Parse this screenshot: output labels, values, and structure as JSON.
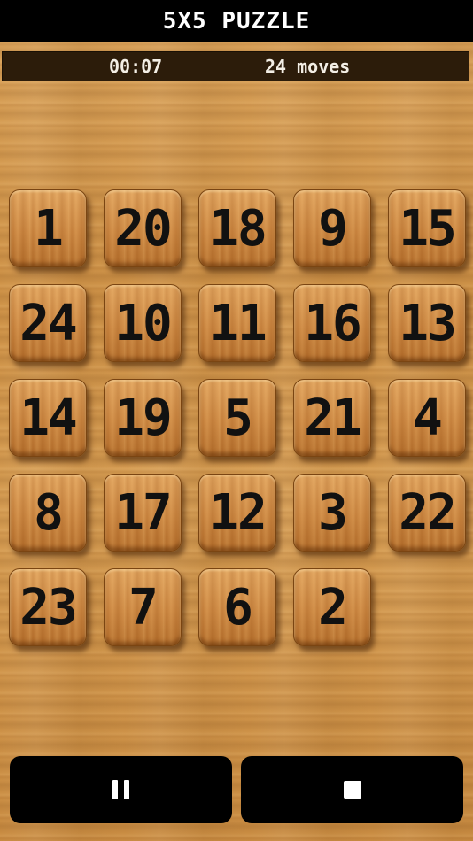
{
  "header": {
    "title": "5X5 PUZZLE"
  },
  "status": {
    "time": "00:07",
    "moves": "24 moves"
  },
  "board": {
    "size": 5,
    "tiles": [
      "1",
      "20",
      "18",
      "9",
      "15",
      "24",
      "10",
      "11",
      "16",
      "13",
      "14",
      "19",
      "5",
      "21",
      "4",
      "8",
      "17",
      "12",
      "3",
      "22",
      "23",
      "7",
      "6",
      "2",
      ""
    ]
  },
  "controls": {
    "pause_icon": "pause-icon",
    "stop_icon": "stop-icon"
  },
  "colors": {
    "bar": "#000000",
    "status_bg": "#2c1c0a",
    "tile_text": "#111111"
  }
}
